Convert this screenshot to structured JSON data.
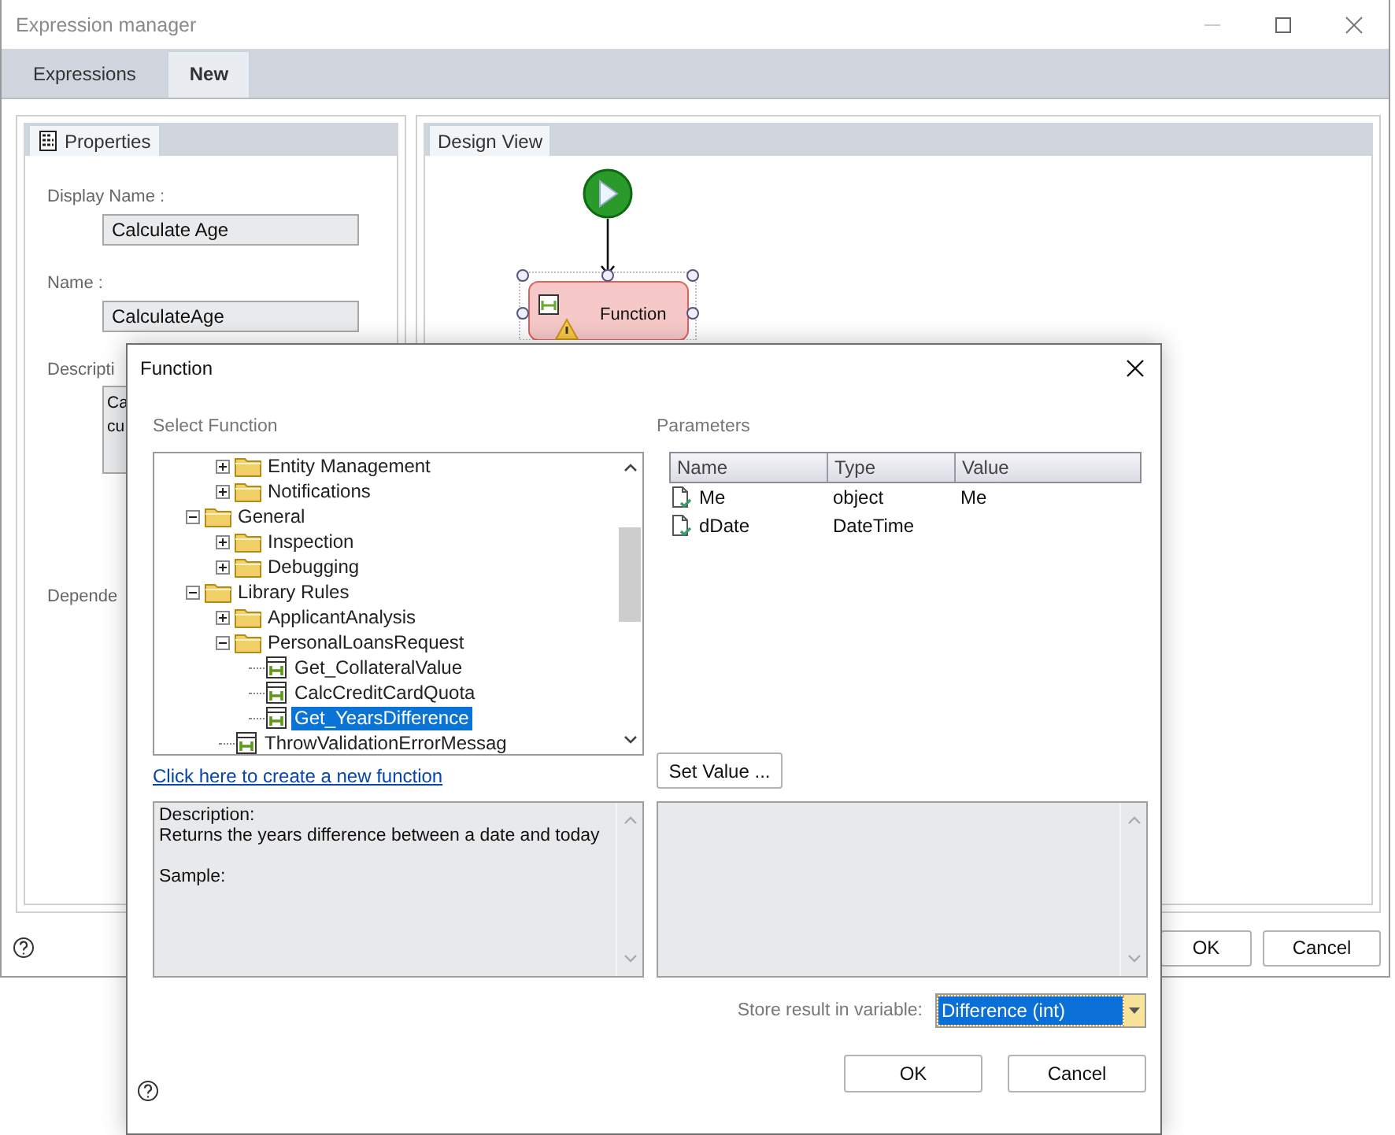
{
  "window": {
    "title": "Expression manager"
  },
  "tabs": [
    {
      "label": "Expressions",
      "selected": false
    },
    {
      "label": "New",
      "selected": true
    }
  ],
  "properties_panel": {
    "tab": "Properties",
    "fields": [
      {
        "label": "Display Name :",
        "value": "Calculate Age"
      },
      {
        "label": "Name :",
        "value": "CalculateAge"
      }
    ],
    "description_label": "Descripti",
    "description_lines": [
      "Ca",
      "cu"
    ],
    "dependencies_label": "Depende"
  },
  "design_view": {
    "tab": "Design View",
    "node": {
      "label": "Function",
      "selected": true,
      "warning": true
    }
  },
  "buttons": [
    "OK",
    "Cancel"
  ],
  "dialog": {
    "title": "Function",
    "select_label": "Select Function",
    "tree": {
      "hidden_parent_children": [
        {
          "label": "Entity Management",
          "kind": "folder",
          "expanded": false,
          "selected": false
        },
        {
          "label": "Notifications",
          "kind": "folder",
          "expanded": false,
          "selected": false
        }
      ],
      "items": [
        {
          "label": "General",
          "kind": "folder",
          "expanded": true,
          "selected": false,
          "children": [
            {
              "label": "Inspection",
              "kind": "folder",
              "expanded": false,
              "selected": false
            },
            {
              "label": "Debugging",
              "kind": "folder",
              "expanded": false,
              "selected": false
            }
          ]
        },
        {
          "label": "Library Rules",
          "kind": "folder",
          "expanded": true,
          "selected": false,
          "children": [
            {
              "label": "ApplicantAnalysis",
              "kind": "folder",
              "expanded": false,
              "selected": false
            },
            {
              "label": "PersonalLoansRequest",
              "kind": "folder",
              "expanded": true,
              "selected": false,
              "children": [
                {
                  "label": "Get_CollateralValue",
                  "kind": "function",
                  "selected": false
                },
                {
                  "label": "CalcCreditCardQuota",
                  "kind": "function",
                  "selected": false
                },
                {
                  "label": "Get_YearsDifference",
                  "kind": "function",
                  "selected": true
                }
              ]
            },
            {
              "label": "ThrowValidationErrorMessag",
              "kind": "function",
              "selected": false
            }
          ]
        }
      ]
    },
    "create_link": "Click here to create a new function",
    "parameters_label": "Parameters",
    "parameters": {
      "columns": [
        "Name",
        "Type",
        "Value"
      ],
      "rows": [
        {
          "name": "Me",
          "type": "object",
          "value": "Me"
        },
        {
          "name": "dDate",
          "type": "DateTime"
        }
      ]
    },
    "set_value_button": "Set Value ...",
    "description": {
      "heading": "Description:",
      "text": "Returns the years difference between a date and today",
      "sample": "Sample:"
    },
    "store_label": "Store result in variable:",
    "store_value": "Difference (int)",
    "buttons": [
      "OK",
      "Cancel"
    ]
  }
}
